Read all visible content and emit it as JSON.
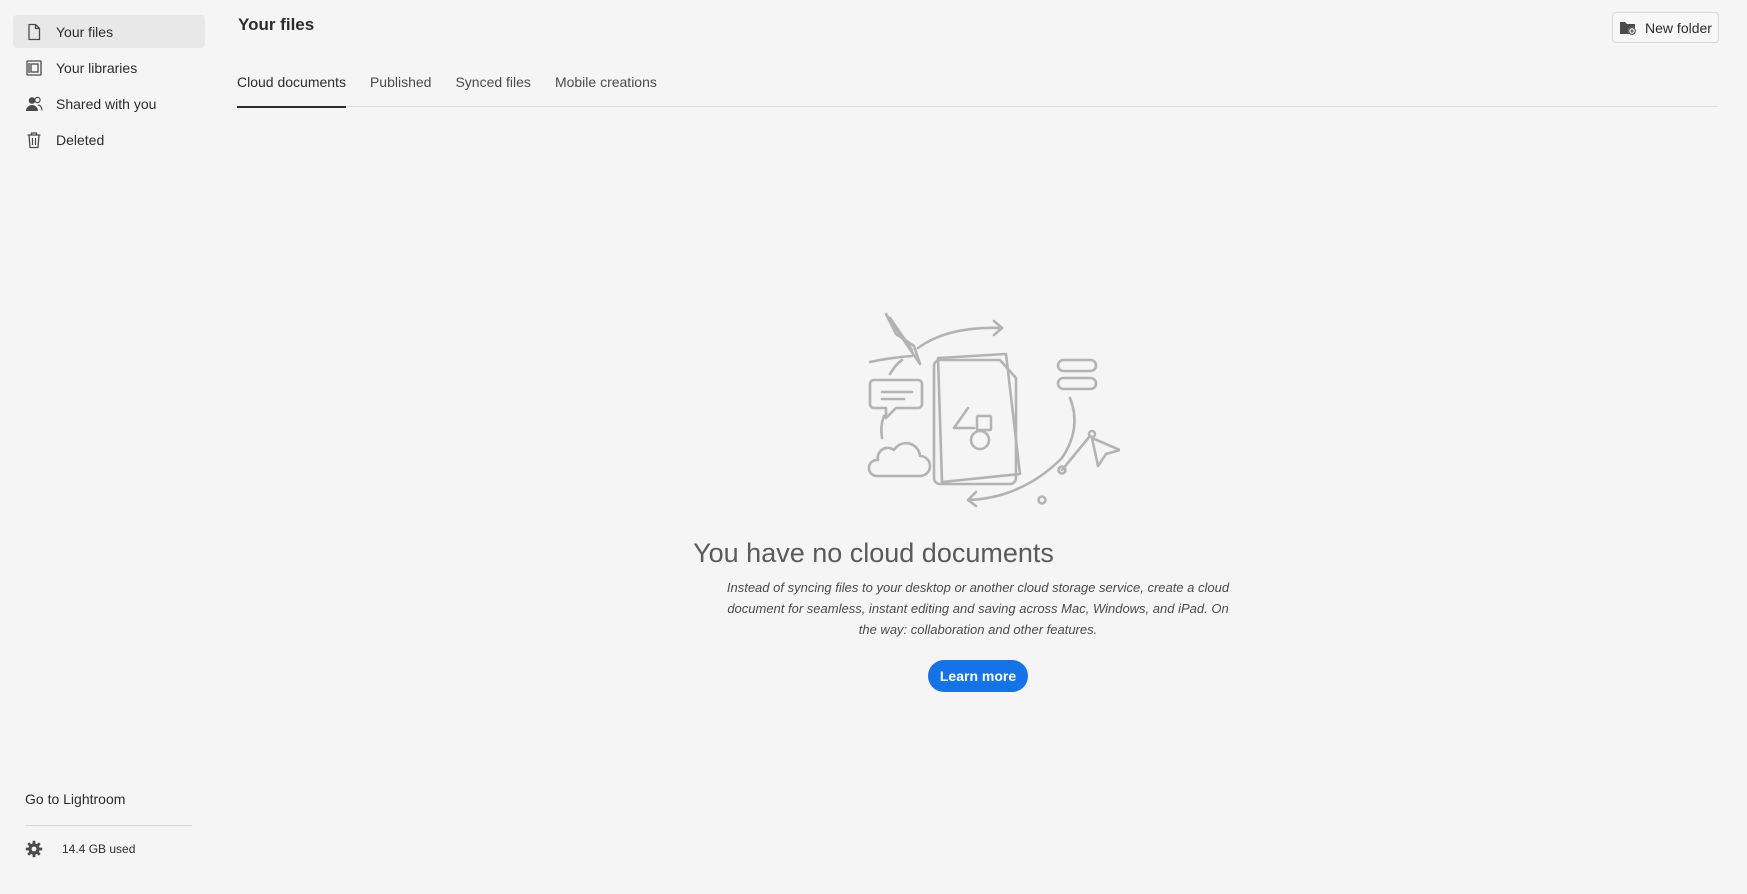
{
  "sidebar": {
    "items": [
      {
        "label": "Your files",
        "icon": "document-icon",
        "selected": true
      },
      {
        "label": "Your libraries",
        "icon": "library-icon",
        "selected": false
      },
      {
        "label": "Shared with you",
        "icon": "users-icon",
        "selected": false
      },
      {
        "label": "Deleted",
        "icon": "trash-icon",
        "selected": false
      }
    ],
    "lightroom_link": "Go to Lightroom",
    "storage_used": "14.4 GB used"
  },
  "header": {
    "title": "Your files",
    "new_folder_label": "New folder"
  },
  "tabs": [
    {
      "label": "Cloud documents",
      "active": true
    },
    {
      "label": "Published",
      "active": false
    },
    {
      "label": "Synced files",
      "active": false
    },
    {
      "label": "Mobile creations",
      "active": false
    }
  ],
  "empty_state": {
    "title": "You have no cloud documents",
    "description": "Instead of syncing files to your desktop or another cloud storage service, create a cloud document for seamless, instant editing and saving across Mac, Windows, and iPad. On the way: collaboration and other features.",
    "button_label": "Learn more"
  },
  "colors": {
    "accent": "#1473e6",
    "background": "#f5f5f5",
    "selected_bg": "#e8e8e8",
    "illustration_stroke": "#b3b3b3"
  }
}
